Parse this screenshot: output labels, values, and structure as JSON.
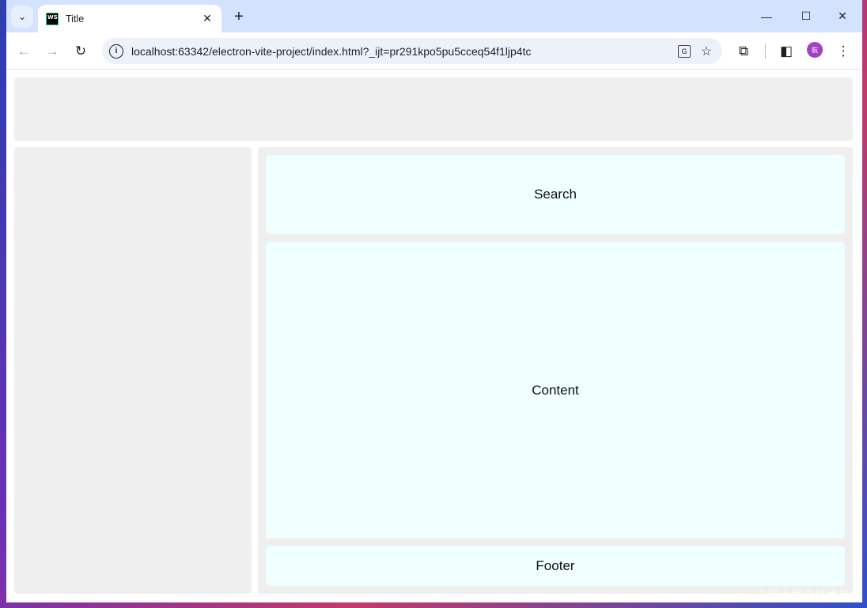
{
  "browser": {
    "tab_title": "Title",
    "favicon_text": "WS",
    "tab_close": "✕",
    "new_tab": "+",
    "tab_list_icon": "⌄",
    "window_controls": {
      "minimize": "—",
      "maximize": "☐",
      "close": "✕"
    },
    "nav": {
      "back": "←",
      "forward": "→",
      "reload": "↻"
    },
    "url": "localhost:63342/electron-vite-project/index.html?_ijt=pr291kpo5pu5cceq54f1ljp4tc",
    "site_info_icon": "i",
    "translate_icon": "G",
    "bookmark_icon": "☆",
    "extensions_icon": "⧉",
    "side_panel_icon": "◧",
    "avatar_text": "航",
    "menu_icon": "⋮"
  },
  "page": {
    "search_label": "Search",
    "content_label": "Content",
    "footer_label": "Footer"
  },
  "watermark": "@稀土掘金技术社区",
  "colors": {
    "tabstrip": "#d3e3fd",
    "omnibox": "#edf2fa",
    "layout_box": "#efefef",
    "panel": "#f0ffff",
    "avatar": "#a142c4"
  }
}
